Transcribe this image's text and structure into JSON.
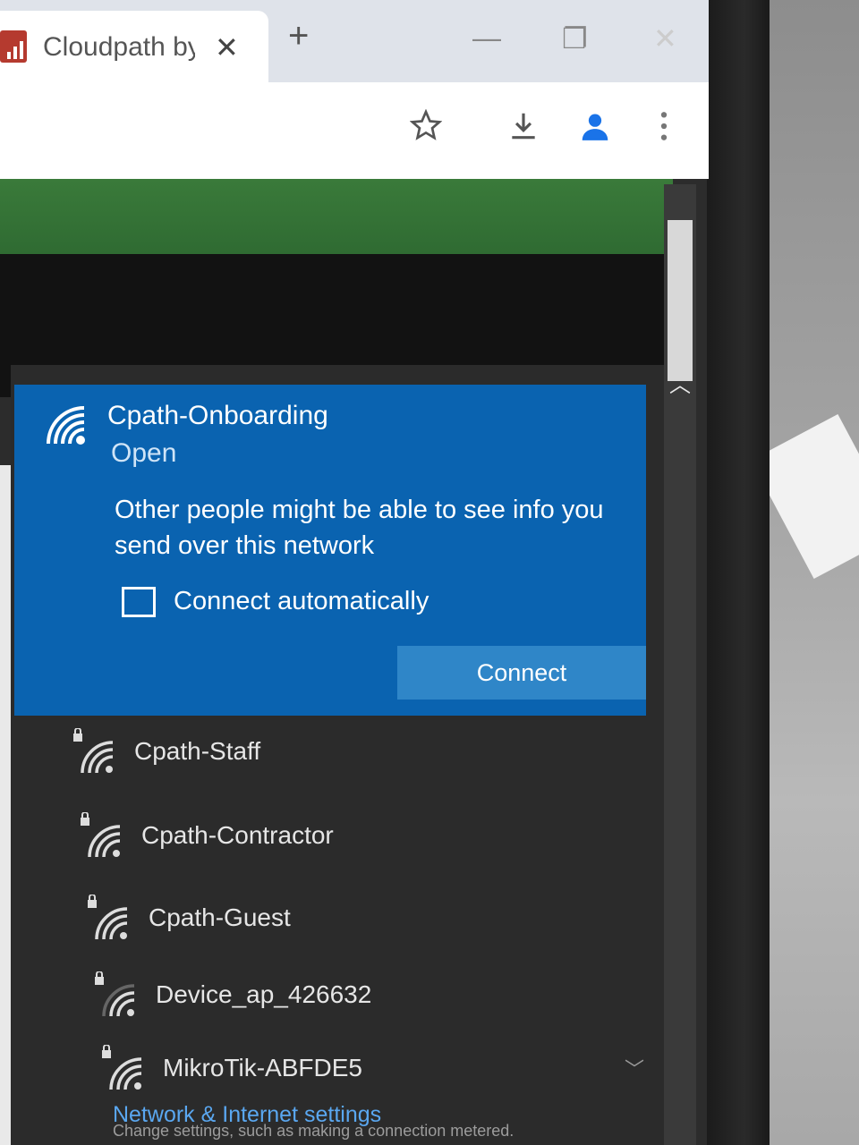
{
  "browser": {
    "tab_title": "Cloudpath by",
    "tab_close": "✕",
    "new_tab": "+",
    "minimize": "—",
    "restore": "❐",
    "close": "✕",
    "toolbar_icons": [
      "star-icon",
      "download-icon",
      "profile-icon",
      "menu-icon"
    ]
  },
  "wifi": {
    "selected": {
      "name": "Cpath-Onboarding",
      "status": "Open",
      "warning": "Other people might be able to see info you send over this network",
      "auto_connect_label": "Connect automatically",
      "auto_connect_checked": false,
      "connect_label": "Connect"
    },
    "networks": [
      {
        "name": "Cpath-Staff",
        "secured": true
      },
      {
        "name": "Cpath-Contractor",
        "secured": true
      },
      {
        "name": "Cpath-Guest",
        "secured": true
      },
      {
        "name": "Device_ap_426632",
        "secured": true
      },
      {
        "name": "MikroTik-ABFDE5",
        "secured": true
      }
    ],
    "settings_link": "Network & Internet settings",
    "settings_sub": "Change settings, such as making a connection metered."
  },
  "colors": {
    "selected_bg": "#0a63b0",
    "connect_button": "#2f86c8",
    "link": "#5aa7f0"
  }
}
